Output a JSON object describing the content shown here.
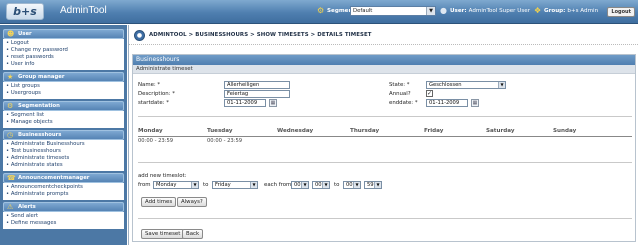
{
  "app": {
    "title": "AdminTool",
    "logo_text": "b+s"
  },
  "topbar": {
    "segment_label": "Segment:",
    "segment_value": "Default",
    "user_label": "User:",
    "user_value": "AdminTool Super User",
    "group_label": "Group:",
    "group_value": "b+s Admin",
    "logout_label": "Logout"
  },
  "sidebar": {
    "sections": [
      {
        "title": "User",
        "items": [
          "Logout",
          "Change my password",
          "reset passwords",
          "User info"
        ]
      },
      {
        "title": "Group manager",
        "items": [
          "List groups",
          "Usergroups"
        ]
      },
      {
        "title": "Segmentation",
        "items": [
          "Segment list",
          "Manage objects"
        ]
      },
      {
        "title": "Businesshours",
        "items": [
          "Administrate Businesshours",
          "Test businesshours",
          "Administrate timesets",
          "Administrate states"
        ]
      },
      {
        "title": "Announcementmanager",
        "items": [
          "Announcementcheckpoints",
          "Administrate prompts"
        ]
      },
      {
        "title": "Alerts",
        "items": [
          "Send alert",
          "Define messages"
        ]
      }
    ]
  },
  "breadcrumb": "AdminTool > Businesshours > show timesets > details timeset",
  "panel": {
    "title": "Businesshours",
    "subtitle": "Administrate timeset"
  },
  "form": {
    "name_label": "Name: *",
    "name_value": "Allerheiligen",
    "description_label": "Description: *",
    "description_value": "Feiertag",
    "startdate_label": "startdate: *",
    "startdate_value": "01-11-2009",
    "state_label": "State: *",
    "state_value": "Geschlossen",
    "annual_label": "Annual?",
    "annual_checked": true,
    "enddate_label": "enddate: *",
    "enddate_value": "01-11-2009"
  },
  "week": {
    "days": [
      "Monday",
      "Tuesday",
      "Wednesday",
      "Thursday",
      "Friday",
      "Saturday",
      "Sunday"
    ],
    "times": [
      "00:00 - 23:59",
      "00:00 - 23:59"
    ]
  },
  "new_timeslot": {
    "label": "add new timeslot:",
    "from_label": "from",
    "from_day": "Monday",
    "to_label": "to",
    "to_day": "Friday",
    "each_from_label": "each from",
    "from_hour": "00",
    "from_min": "00",
    "to_label2": "to",
    "to_hour": "00",
    "to_min": "59"
  },
  "buttons": {
    "add_times": "Add times",
    "always": "Always?",
    "save_timeset": "Save timeset",
    "back": "Back"
  },
  "colors": {
    "topbar": "#4f7fb0",
    "sidebar": "#4c78a5",
    "panel_header": "#4f7fb0"
  }
}
